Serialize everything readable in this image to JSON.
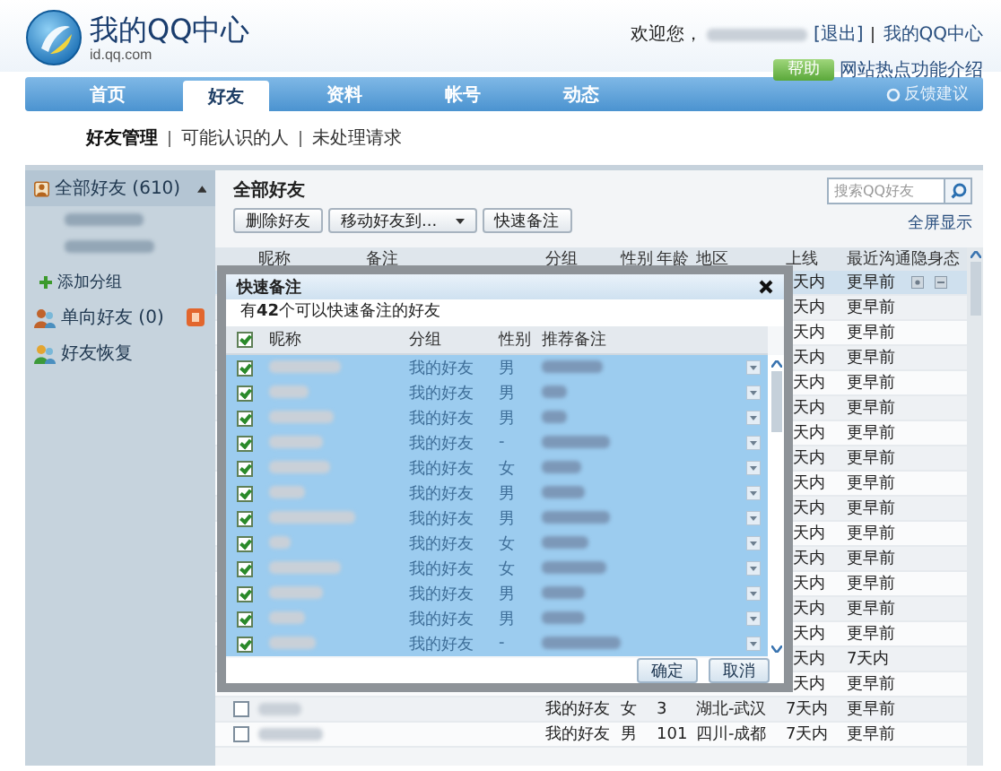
{
  "header": {
    "logo_title": "我的QQ中心",
    "logo_subtitle": "id.qq.com",
    "welcome": "欢迎您，",
    "logout": "[退出]",
    "my_center": "我的QQ中心",
    "help_badge": "帮助",
    "help_link": "网站热点功能介绍"
  },
  "nav": {
    "tabs": [
      {
        "label": "首页",
        "selected": false
      },
      {
        "label": "好友",
        "selected": true
      },
      {
        "label": "资料",
        "selected": false
      },
      {
        "label": "帐号",
        "selected": false
      },
      {
        "label": "动态",
        "selected": false
      }
    ],
    "feedback": "反馈建议"
  },
  "subnav": [
    {
      "label": "好友管理",
      "selected": true
    },
    {
      "label": "可能认识的人",
      "selected": false
    },
    {
      "label": "未处理请求",
      "selected": false
    }
  ],
  "sidebar": {
    "items": [
      {
        "kind": "group",
        "label": "全部好友 (610)",
        "selected": true,
        "expanded": true
      },
      {
        "kind": "subgroup",
        "selected": false
      },
      {
        "kind": "subgroup",
        "selected": false
      },
      {
        "kind": "add",
        "label": "添加分组",
        "selected": false
      },
      {
        "kind": "oneway",
        "label": "单向好友 (0)",
        "selected": false
      },
      {
        "kind": "restore",
        "label": "好友恢复",
        "selected": false
      }
    ]
  },
  "content": {
    "title": "全部好友",
    "toolbar": [
      {
        "kind": "button",
        "label": "删除好友"
      },
      {
        "kind": "dropdown",
        "label": "移动好友到..."
      },
      {
        "kind": "button",
        "label": "快速备注"
      }
    ],
    "search": {
      "placeholder": "搜索QQ好友"
    },
    "fullscreen_link": "全屏显示",
    "table": {
      "columns": [
        "昵称",
        "备注",
        "分组",
        "性别",
        "年龄",
        "地区",
        "上线",
        "最近沟通",
        "隐身态"
      ],
      "rows": [
        {
          "kind": "partial",
          "selected": true,
          "online": "天内",
          "recent": "更早前"
        },
        {
          "kind": "partial",
          "selected": false,
          "online": "天内",
          "recent": "更早前"
        },
        {
          "kind": "partial",
          "selected": false,
          "online": "天内",
          "recent": "更早前"
        },
        {
          "kind": "partial",
          "selected": false,
          "online": "天内",
          "recent": "更早前"
        },
        {
          "kind": "partial",
          "selected": false,
          "online": "天内",
          "recent": "更早前"
        },
        {
          "kind": "partial",
          "selected": false,
          "online": "天内",
          "recent": "更早前"
        },
        {
          "kind": "partial",
          "selected": false,
          "online": "天内",
          "recent": "更早前"
        },
        {
          "kind": "partial",
          "selected": false,
          "online": "天内",
          "recent": "更早前"
        },
        {
          "kind": "partial",
          "selected": false,
          "online": "天内",
          "recent": "更早前"
        },
        {
          "kind": "partial",
          "selected": false,
          "online": "天内",
          "recent": "更早前"
        },
        {
          "kind": "partial",
          "selected": false,
          "online": "天内",
          "recent": "更早前"
        },
        {
          "kind": "partial",
          "selected": false,
          "online": "天内",
          "recent": "更早前"
        },
        {
          "kind": "partial",
          "selected": false,
          "online": "天内",
          "recent": "更早前"
        },
        {
          "kind": "partial",
          "selected": false,
          "online": "天内",
          "recent": "更早前"
        },
        {
          "kind": "partial",
          "selected": false,
          "online": "天内",
          "recent": "更早前"
        },
        {
          "kind": "partial",
          "selected": false,
          "online": "天内",
          "recent": "7天内"
        },
        {
          "kind": "partial",
          "selected": false,
          "online": "天内",
          "recent": "更早前"
        },
        {
          "kind": "full",
          "selected": false,
          "checked": false,
          "group": "我的好友",
          "gender": "女",
          "age": "3",
          "region": "湖北-武汉",
          "online": "7天内",
          "recent": "更早前"
        },
        {
          "kind": "full",
          "selected": false,
          "checked": false,
          "group": "我的好友",
          "gender": "男",
          "age": "101",
          "region": "四川-成都",
          "online": "7天内",
          "recent": "更早前"
        }
      ]
    }
  },
  "dialog": {
    "title": "快速备注",
    "info": "有**42**个可以快速备注的好友",
    "select_all_checked": true,
    "columns": [
      "昵称",
      "分组",
      "性别",
      "推荐备注"
    ],
    "rows": [
      {
        "checked": true,
        "group": "我的好友",
        "gender": "男"
      },
      {
        "checked": true,
        "group": "我的好友",
        "gender": "男"
      },
      {
        "checked": true,
        "group": "我的好友",
        "gender": "男"
      },
      {
        "checked": true,
        "group": "我的好友",
        "gender": "-"
      },
      {
        "checked": true,
        "group": "我的好友",
        "gender": "女"
      },
      {
        "checked": true,
        "group": "我的好友",
        "gender": "男"
      },
      {
        "checked": true,
        "group": "我的好友",
        "gender": "男"
      },
      {
        "checked": true,
        "group": "我的好友",
        "gender": "女"
      },
      {
        "checked": true,
        "group": "我的好友",
        "gender": "女"
      },
      {
        "checked": true,
        "group": "我的好友",
        "gender": "男"
      },
      {
        "checked": true,
        "group": "我的好友",
        "gender": "男"
      },
      {
        "checked": true,
        "group": "我的好友",
        "gender": "-"
      }
    ],
    "buttons": [
      "确定",
      "取消"
    ]
  }
}
